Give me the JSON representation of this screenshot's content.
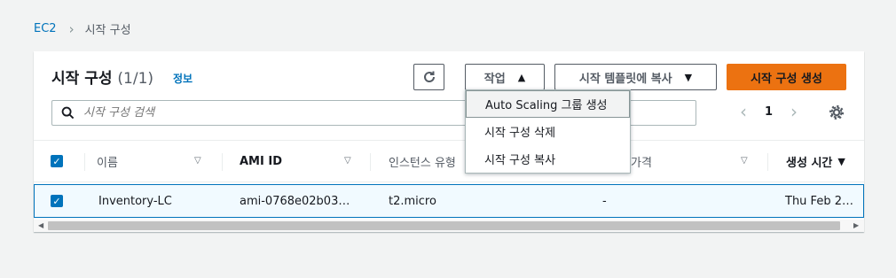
{
  "breadcrumb": {
    "root": "EC2",
    "current": "시작 구성"
  },
  "header": {
    "title": "시작 구성",
    "count": "(1/1)",
    "info": "정보"
  },
  "toolbar": {
    "actions_label": "작업",
    "copy_label": "시작 템플릿에 복사",
    "create_label": "시작 구성 생성"
  },
  "search": {
    "placeholder": "시작 구성 검색"
  },
  "pagination": {
    "page": "1"
  },
  "table": {
    "columns": [
      "이름",
      "AMI ID",
      "인스턴스 유형",
      "가격",
      "생성 시간"
    ],
    "rows": [
      {
        "name": "Inventory-LC",
        "ami": "ami-0768e02b03…",
        "type": "t2.micro",
        "price": "-",
        "created": "Thu Feb 2…"
      }
    ]
  },
  "actions_menu": {
    "items": [
      "Auto Scaling 그룹 생성",
      "시작 구성 삭제",
      "시작 구성 복사"
    ]
  },
  "colors": {
    "primary": "#ec7211",
    "link": "#0073bb",
    "selected_row": "#f1faff"
  },
  "icons": [
    "chevron-right-icon",
    "refresh-icon",
    "caret-up-icon",
    "caret-down-icon",
    "search-icon",
    "chevron-left-icon",
    "settings-icon",
    "sort-down-icon",
    "checkbox-checked-icon"
  ]
}
